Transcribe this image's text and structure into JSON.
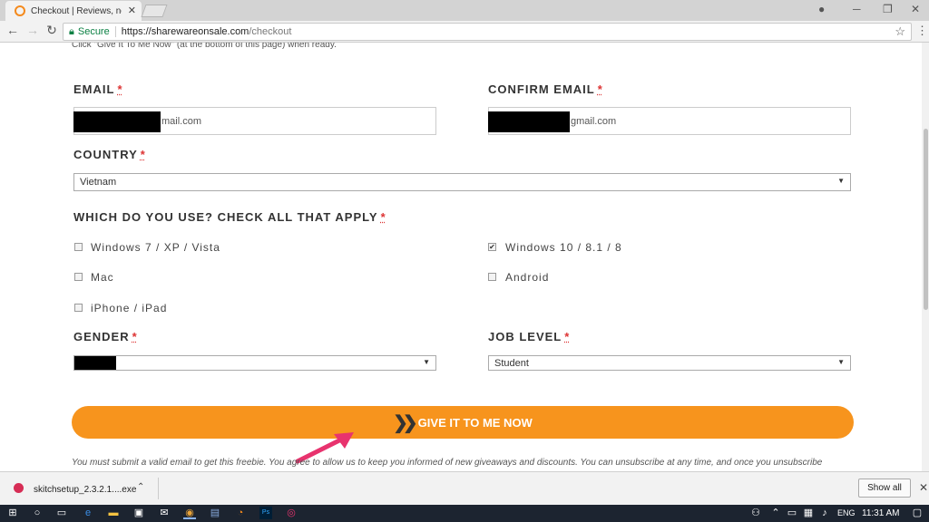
{
  "browser": {
    "tab_title": "Checkout | Reviews, new",
    "tab_close": "✕",
    "url_secure_label": "Secure",
    "url_host": "https://sharewareonsale.com",
    "url_path": "/checkout"
  },
  "page": {
    "top_note": "Click \"Give It To Me Now\" (at the bottom of this page) when ready.",
    "email_label": "EMAIL",
    "email_value": "mail.com",
    "confirm_email_label": "CONFIRM EMAIL",
    "confirm_email_value": "gmail.com",
    "country_label": "COUNTRY",
    "country_value": "Vietnam",
    "which_label": "WHICH DO YOU USE? CHECK ALL THAT APPLY",
    "options": [
      {
        "label": "Windows 7 / XP / Vista",
        "checked": false
      },
      {
        "label": "Windows 10 / 8.1 / 8",
        "checked": true
      },
      {
        "label": "Mac",
        "checked": false
      },
      {
        "label": "Android",
        "checked": false
      },
      {
        "label": "iPhone / iPad",
        "checked": false
      }
    ],
    "gender_label": "GENDER",
    "job_label": "JOB LEVEL",
    "job_value": "Student",
    "required_mark": "*",
    "button_label": "GIVE IT TO ME NOW",
    "disclaimer": "You must submit a valid email to get this freebie. You agree to allow us to keep you informed of new giveaways and discounts. You can unsubscribe at any time, and once you unsubscribe"
  },
  "downloads": {
    "file_name": "skitchsetup_2.3.2.1....exe",
    "show_all": "Show all"
  },
  "taskbar": {
    "lang": "ENG",
    "time": "11:31 AM"
  },
  "colors": {
    "button": "#f7941d",
    "secure": "#0b8043",
    "arrow": "#e8336e"
  }
}
